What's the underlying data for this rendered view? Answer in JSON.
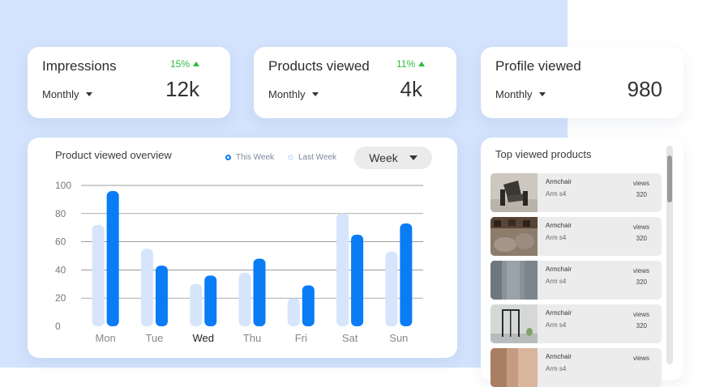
{
  "stats": [
    {
      "title": "Impressions",
      "delta": "15%",
      "period": "Monthly",
      "value": "12k"
    },
    {
      "title": "Products viewed",
      "delta": "11%",
      "period": "Monthly",
      "value": "4k"
    },
    {
      "title": "Profile viewed",
      "delta": "",
      "period": "Monthly",
      "value": "980"
    }
  ],
  "overview": {
    "title": "Product viewed overview",
    "legend_this": "This Week",
    "legend_last": "Last Week",
    "range_button": "Week"
  },
  "chart_data": {
    "type": "bar",
    "categories": [
      "Mon",
      "Tue",
      "Wed",
      "Thu",
      "Fri",
      "Sat",
      "Sun"
    ],
    "highlight_category": "Wed",
    "series": [
      {
        "name": "Last Week",
        "color": "#d6e5fb",
        "values": [
          72,
          55,
          30,
          38,
          20,
          80,
          53
        ]
      },
      {
        "name": "This Week",
        "color": "#0a7cf5",
        "values": [
          96,
          43,
          36,
          48,
          29,
          65,
          73
        ]
      }
    ],
    "yticks": [
      "0",
      "20",
      "40",
      "60",
      "80",
      "100"
    ],
    "ylim": [
      0,
      100
    ],
    "grid": true
  },
  "top_products": {
    "title": "Top viewed products",
    "items": [
      {
        "name": "Armchair",
        "sub": "Arm s4",
        "views_label": "views",
        "views": "320"
      },
      {
        "name": "Armchair",
        "sub": "Arm s4",
        "views_label": "views",
        "views": "320"
      },
      {
        "name": "Armchair",
        "sub": "Arm s4",
        "views_label": "views",
        "views": "320"
      },
      {
        "name": "Armchair",
        "sub": "Arm s4",
        "views_label": "views",
        "views": "320"
      },
      {
        "name": "Armchair",
        "sub": "Arm s4",
        "views_label": "views",
        "views": ""
      }
    ]
  },
  "colors": {
    "accent": "#0a7cf5",
    "accent_light": "#d6e5fb",
    "positive": "#2dbb3c",
    "background": "#d3e3fd"
  }
}
